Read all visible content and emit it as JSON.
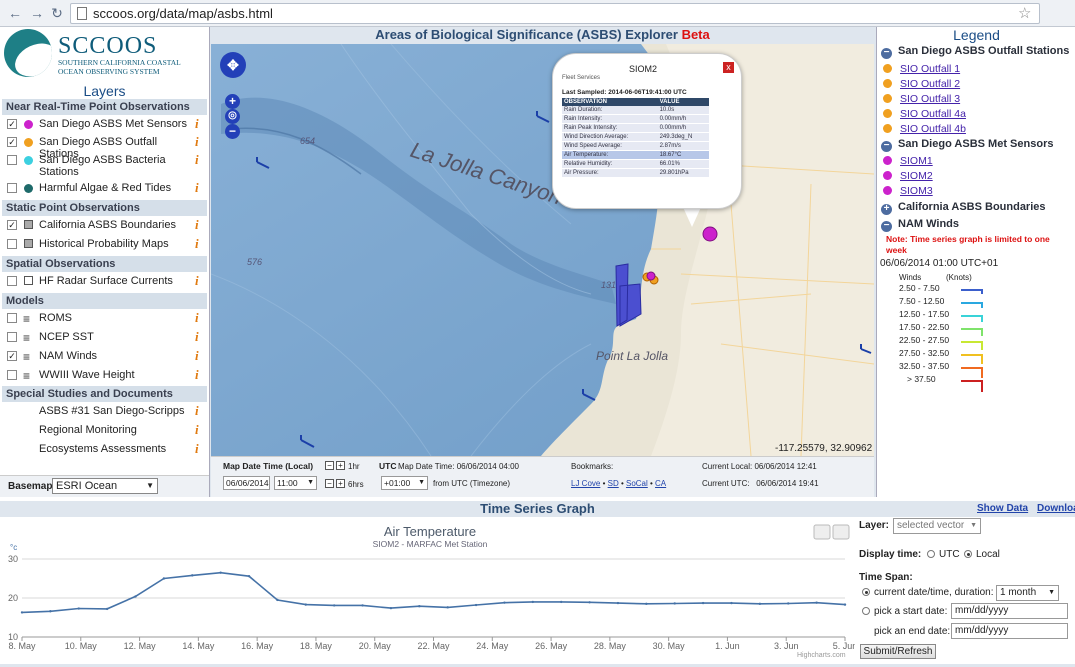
{
  "browser": {
    "url": "sccoos.org/data/map/asbs.html"
  },
  "sidebar": {
    "logo_title": "SCCOOS",
    "logo_subtitle": "SOUTHERN CALIFORNIA COASTAL OCEAN OBSERVING SYSTEM",
    "layers_title": "Layers",
    "sections": {
      "near": "Near Real-Time Point Observations",
      "static": "Static Point Observations",
      "spatial": "Spatial Observations",
      "models": "Models",
      "special": "Special Studies and Documents"
    },
    "items": {
      "met": "San Diego ASBS Met Sensors",
      "outfall": "San Diego ASBS Outfall Stations",
      "bacteria": "San Diego ASBS Bacteria Stations",
      "algae": "Harmful Algae & Red Tides",
      "boundaries": "California ASBS Boundaries",
      "historical": "Historical Probability Maps",
      "hf": "HF Radar Surface Currents",
      "roms": "ROMS",
      "ncep": "NCEP SST",
      "nam": "NAM Winds",
      "wwiii": "WWIII Wave Height",
      "asbs31": "ASBS #31 San Diego-Scripps",
      "regional": "Regional Monitoring",
      "eco": "Ecosystems Assessments"
    },
    "info_glyph": "i",
    "basemap_label": "Basemap:",
    "basemap_value": "ESRI Ocean"
  },
  "map": {
    "title": "Areas of Biological Significance (ASBS) Explorer",
    "beta": "Beta",
    "labels": {
      "canyon": "La Jolla Canyon",
      "point": "Point La Jolla",
      "d654": "654",
      "d576": "576",
      "d131": "131"
    },
    "coords": "-117.25579, 32.90962"
  },
  "popup": {
    "title": "SIOM2",
    "close": "x",
    "subtitle": "Fleet Services",
    "last_sampled": "Last Sampled: 2014-06-06T19:41:00 UTC",
    "headers": [
      "OBSERVATION",
      "VALUE"
    ],
    "rows": [
      [
        "Rain Duration:",
        "10.0s"
      ],
      [
        "Rain Intensity:",
        "0.00mm/h"
      ],
      [
        "Rain Peak Intensity:",
        "0.00mm/h"
      ],
      [
        "Wind Direction Average:",
        "249.3deg_N"
      ],
      [
        "Wind Speed Average:",
        "2.87m/s"
      ],
      [
        "Air Temperature:",
        "18.67°C"
      ],
      [
        "Relative Humidity:",
        "66.01%"
      ],
      [
        "Air Pressure:",
        "29.801hPa"
      ]
    ]
  },
  "timebar": {
    "map_date_label": "Map Date Time (Local)",
    "hr1": "1hr",
    "hr6": "6hrs",
    "utc_label": "UTC",
    "utc_text": "Map Date Time: 06/06/2014 04:00",
    "date": "06/06/2014",
    "time": "11:00",
    "offset": "+01:00",
    "from_utc": "from UTC (Timezone)",
    "bookmarks_label": "Bookmarks:",
    "bookmarks": [
      "LJ Cove",
      "SD",
      "SoCal",
      "CA"
    ],
    "current_local": "Current Local: 06/06/2014 12:41",
    "current_utc": "Current UTC:   06/06/2014 19:41"
  },
  "legend": {
    "title": "Legend",
    "outfall_group": "San Diego ASBS Outfall Stations",
    "outfall_items": [
      "SIO Outfall 1",
      "SIO Outfall 2",
      "SIO Outfall 3",
      "SIO Outfall 4a",
      "SIO Outfall 4b"
    ],
    "met_group": "San Diego ASBS Met Sensors",
    "met_items": [
      "SIOM1",
      "SIOM2",
      "SIOM3"
    ],
    "boundaries_group": "California ASBS Boundaries",
    "nam_group": "NAM Winds",
    "nam_note": "Note: Time series graph is limited to one week",
    "nam_datetime": "06/06/2014 01:00 UTC+01",
    "winds_head": "Winds",
    "knots_head": "(Knots)",
    "wind_rows": [
      "2.50  -  7.50",
      "7.50  -  12.50",
      "12.50 - 17.50",
      "17.50 - 22.50",
      "22.50 - 27.50",
      "27.50 - 32.50",
      "32.50 - 37.50",
      "> 37.50"
    ],
    "wind_colors": [
      "#3b5fcc",
      "#2aa8e0",
      "#39d3d8",
      "#7fe36b",
      "#c8e832",
      "#f0c020",
      "#f06a20",
      "#cc2020"
    ],
    "outfall_color": "#f0a020",
    "met_color": "#cc22cc"
  },
  "timeseries": {
    "section_title": "Time Series Graph",
    "show_data": "Show Data",
    "download": "Download",
    "credit": "Highcharts.com"
  },
  "controls": {
    "layer_label": "Layer:",
    "layer_value": "selected vector",
    "display_label": "Display time:",
    "utc": "UTC",
    "local": "Local",
    "span_label": "Time Span:",
    "current_label": "current date/time, duration:",
    "duration": "1 month",
    "start_label": "pick a start date:",
    "end_label": "pick an end date:",
    "date_placeholder": "mm/dd/yyyy",
    "submit": "Submit/Refresh"
  },
  "chart_data": {
    "type": "line",
    "title": "Air Temperature",
    "subtitle": "SIOM2 - MARFAC Met Station",
    "ylabel": "°c",
    "xlabel": "",
    "ylim": [
      10,
      30
    ],
    "yticks": [
      10,
      20,
      30
    ],
    "x_ticks": [
      "8. May",
      "10. May",
      "12. May",
      "14. May",
      "16. May",
      "18. May",
      "20. May",
      "22. May",
      "24. May",
      "26. May",
      "28. May",
      "30. May",
      "1. Jun",
      "3. Jun",
      "5. Jun"
    ],
    "grid": true,
    "legend": "none",
    "series": [
      {
        "color": "#4572a7",
        "x": [
          0,
          1,
          2,
          3,
          4,
          5,
          6,
          7,
          8,
          9,
          10,
          11,
          12,
          13,
          14,
          15,
          16,
          17,
          18,
          19,
          20,
          21,
          22,
          23,
          24,
          25,
          26,
          27,
          28,
          29
        ],
        "values": [
          16.3,
          16.6,
          17.3,
          17.2,
          20.4,
          25.0,
          25.8,
          26.5,
          25.6,
          19.5,
          18.3,
          18.1,
          18.1,
          17.4,
          17.9,
          17.6,
          18.2,
          18.8,
          19.0,
          19.0,
          18.9,
          18.7,
          18.5,
          18.6,
          18.7,
          18.7,
          18.5,
          18.6,
          18.8,
          18.3
        ]
      }
    ]
  }
}
